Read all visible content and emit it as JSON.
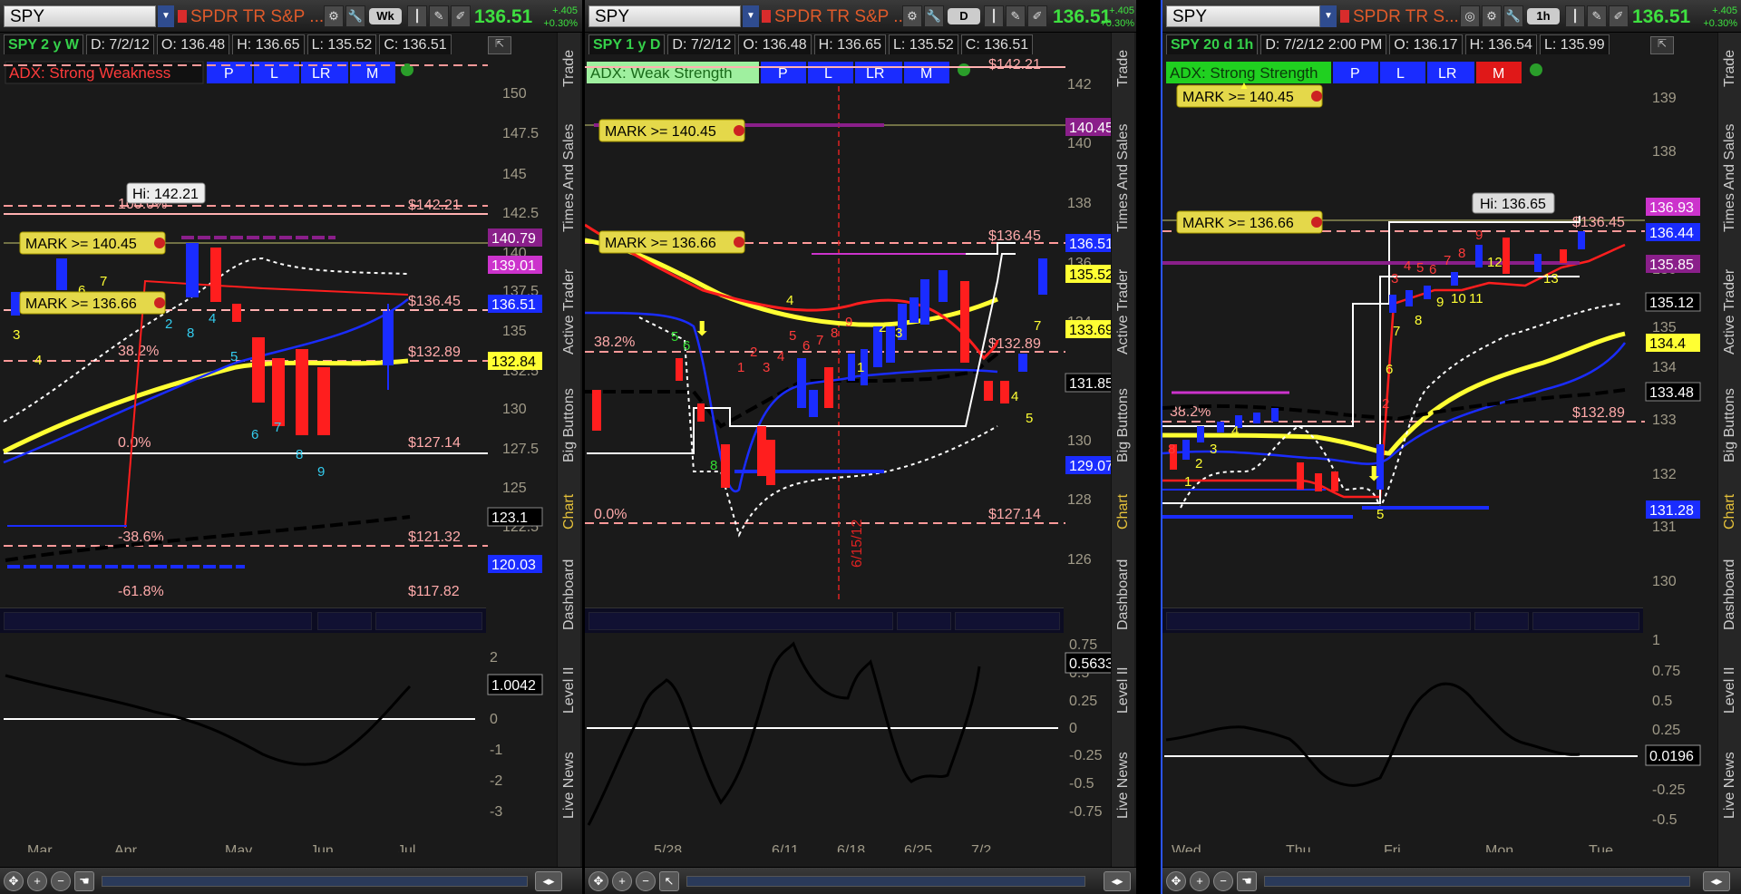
{
  "colors": {
    "green": "#3ee040",
    "red": "#ff1e1e",
    "yellow": "#ffff33",
    "blue": "#1a2cff",
    "pink": "#ffb0b0",
    "magenta": "#cc33cc",
    "bg": "#1a1a1a"
  },
  "side_tabs": [
    "Trade",
    "Times And Sales",
    "Active Trader",
    "Big Buttons",
    "Chart",
    "Dashboard",
    "Level II",
    "Live News"
  ],
  "panels": [
    {
      "symbol": "SPY",
      "name": "SPDR TR S&P ...",
      "aggregation": "Wk",
      "last": "136.51",
      "change": "+.405",
      "change_pct": "+0.30%",
      "title": "SPY 2 y W",
      "date": "D: 7/2/12",
      "open": "O: 136.48",
      "high": "H: 136.65",
      "low": "L: 135.52",
      "close": "C: 136.51",
      "adx": "ADX:  Strong Weakness",
      "adx_color": "#e01818",
      "adx_text": "#ff3b3b",
      "buttons": [
        "P",
        "L",
        "LR",
        "M"
      ],
      "hi_label": "Hi: 142.21",
      "marks": [
        "MARK >= 140.45",
        "MARK >= 136.66"
      ],
      "right_axis": [
        "150",
        "147.5",
        "145",
        "142.5",
        "140",
        "137.5",
        "135",
        "132.5",
        "130",
        "127.5",
        "125",
        "122.5"
      ],
      "price_tags": [
        {
          "v": "140.79",
          "bg": "#8a1f8a",
          "fg": "#fff"
        },
        {
          "v": "139.01",
          "bg": "#cc33cc",
          "fg": "#fff"
        },
        {
          "v": "136.51",
          "bg": "#1a2cff",
          "fg": "#fff"
        },
        {
          "v": "132.84",
          "bg": "#ffff33",
          "fg": "#000"
        },
        {
          "v": "123.1",
          "bg": "#000",
          "fg": "#fff"
        },
        {
          "v": "120.03",
          "bg": "#1a2cff",
          "fg": "#fff"
        }
      ],
      "fib_labels": [
        {
          "t": "$142.21"
        },
        {
          "t": "$136.45"
        },
        {
          "t": "$132.89"
        },
        {
          "t": "$127.14"
        },
        {
          "t": "$121.32"
        },
        {
          "t": "$117.82"
        }
      ],
      "fib_pcts": [
        "100.0%",
        "38.2%",
        "0.0%",
        "-38.6%",
        "-61.8%"
      ],
      "lower_axis": [
        "2",
        "1",
        "0",
        "-1",
        "-2",
        "-3"
      ],
      "lower_tag": "1.0042",
      "time_axis": [
        "Mar",
        "Apr",
        "May",
        "Jun",
        "Jul"
      ]
    },
    {
      "symbol": "SPY",
      "name": "SPDR TR S&P ...",
      "aggregation": "D",
      "last": "136.51",
      "change": "+.405",
      "change_pct": "+0.30%",
      "title": "SPY 1 y D",
      "date": "D: 7/2/12",
      "open": "O: 136.48",
      "high": "H: 136.65",
      "low": "L: 135.52",
      "close": "C: 136.51",
      "adx": "ADX:  Weak Strength",
      "adx_color": "#9ff09f",
      "adx_text": "#1a6b1a",
      "buttons": [
        "P",
        "L",
        "LR",
        "M"
      ],
      "hi_label": "",
      "marks": [
        "MARK >= 140.45",
        "MARK >= 136.66"
      ],
      "right_axis": [
        "142",
        "140",
        "138",
        "136",
        "134",
        "132",
        "130",
        "128",
        "126"
      ],
      "price_tags": [
        {
          "v": "140.45",
          "bg": "#8a1f8a",
          "fg": "#fff"
        },
        {
          "v": "136.51",
          "bg": "#1a2cff",
          "fg": "#fff"
        },
        {
          "v": "135.52",
          "bg": "#ffff33",
          "fg": "#000"
        },
        {
          "v": "133.69",
          "bg": "#ffff33",
          "fg": "#000"
        },
        {
          "v": "131.85",
          "bg": "#000",
          "fg": "#fff"
        },
        {
          "v": "129.07",
          "bg": "#1a2cff",
          "fg": "#fff"
        }
      ],
      "fib_labels": [
        {
          "t": "$142.21"
        },
        {
          "t": "$136.45"
        },
        {
          "t": "$132.89"
        },
        {
          "t": "$127.14"
        }
      ],
      "fib_pcts": [
        "38.2%",
        "0.0%"
      ],
      "vline_label": "6/15/12",
      "lower_axis": [
        "0.75",
        "0.5",
        "0.25",
        "0",
        "-0.25",
        "-0.5",
        "-0.75"
      ],
      "lower_tag": "0.5633",
      "time_axis": [
        "5/28",
        "6/11",
        "6/18",
        "6/25",
        "7/2"
      ]
    },
    {
      "symbol": "SPY",
      "name": "SPDR TR S...",
      "aggregation": "1h",
      "last": "136.51",
      "change": "+.405",
      "change_pct": "+0.30%",
      "title": "SPY 20 d 1h",
      "date": "D: 7/2/12 2:00 PM",
      "open": "O: 136.17",
      "high": "H: 136.54",
      "low": "L: 135.99",
      "close": "",
      "adx": "ADX:  Strong Strength",
      "adx_color": "#20d020",
      "adx_text": "#0a3a0a",
      "buttons": [
        "P",
        "L",
        "LR",
        "M"
      ],
      "hi_label": "Hi: 136.65",
      "marks": [
        "MARK >= 140.45",
        "MARK >= 136.66"
      ],
      "right_axis": [
        "139",
        "138",
        "137",
        "136",
        "135",
        "134",
        "133",
        "132",
        "131",
        "130"
      ],
      "price_tags": [
        {
          "v": "136.93",
          "bg": "#cc33cc",
          "fg": "#fff"
        },
        {
          "v": "136.44",
          "bg": "#1a2cff",
          "fg": "#fff"
        },
        {
          "v": "135.85",
          "bg": "#8a1f8a",
          "fg": "#fff"
        },
        {
          "v": "135.12",
          "bg": "#000",
          "fg": "#fff"
        },
        {
          "v": "134.4",
          "bg": "#ffff33",
          "fg": "#000"
        },
        {
          "v": "133.48",
          "bg": "#000",
          "fg": "#fff"
        },
        {
          "v": "131.28",
          "bg": "#1a2cff",
          "fg": "#fff"
        }
      ],
      "fib_labels": [
        {
          "t": "$136.45"
        },
        {
          "t": "$132.89"
        }
      ],
      "fib_pcts": [
        "38.2%"
      ],
      "lower_axis": [
        "1",
        "0.75",
        "0.5",
        "0.25",
        "0",
        "-0.25",
        "-0.5"
      ],
      "lower_tag": "0.0196",
      "time_axis": [
        "Wed",
        "Thu",
        "Fri",
        "Mon",
        "Tue"
      ]
    }
  ]
}
